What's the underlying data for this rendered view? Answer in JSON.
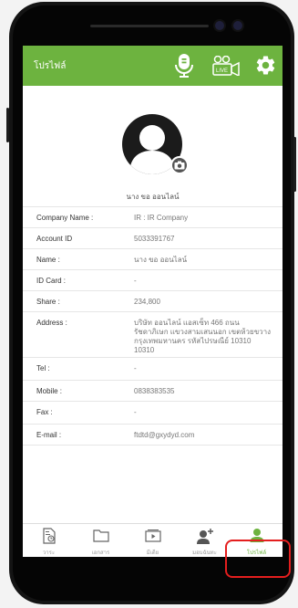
{
  "app": {
    "title": "โปรไฟล์",
    "icons": [
      "microphone-icon",
      "live-camera-icon",
      "gear-icon"
    ],
    "accent_color": "#6db33f",
    "highlight_color": "#e41e1e"
  },
  "profile": {
    "name": "นาง ขอ ออนไลน์",
    "avatar_icon": "user-silhouette-icon",
    "avatar_badge_icon": "camera-icon"
  },
  "fields": [
    {
      "label": "Company Name :",
      "value": "IR : IR Company"
    },
    {
      "label": "Account ID",
      "value": "5033391767"
    },
    {
      "label": "Name :",
      "value": "นาง ขอ ออนไลน์"
    },
    {
      "label": "ID Card :",
      "value": "-"
    },
    {
      "label": "Share :",
      "value": "234,800"
    },
    {
      "label": "Address :",
      "value": "บริษัท ออนไลน์ แอสเซ็ท 466 ถนนรัชดาภิเษก แขวงสามเสนนอก เขตห้วยขวาง กรุงเทพมหานคร รหัสไปรษณีย์ 10310 10310"
    },
    {
      "label": "Tel :",
      "value": "-"
    },
    {
      "label": "Mobile :",
      "value": "0838383535"
    },
    {
      "label": "Fax :",
      "value": "-"
    },
    {
      "label": "E-mail :",
      "value": "ftdtd@gxydyd.com"
    }
  ],
  "nav": [
    {
      "label": "วาระ",
      "icon": "agenda-icon",
      "active": false
    },
    {
      "label": "เอกสาร",
      "icon": "folder-icon",
      "active": false
    },
    {
      "label": "มีเดีย",
      "icon": "media-icon",
      "active": false
    },
    {
      "label": "มอบฉันทะ",
      "icon": "add-user-icon",
      "active": false
    },
    {
      "label": "โปรไฟล์",
      "icon": "profile-icon",
      "active": true
    }
  ]
}
